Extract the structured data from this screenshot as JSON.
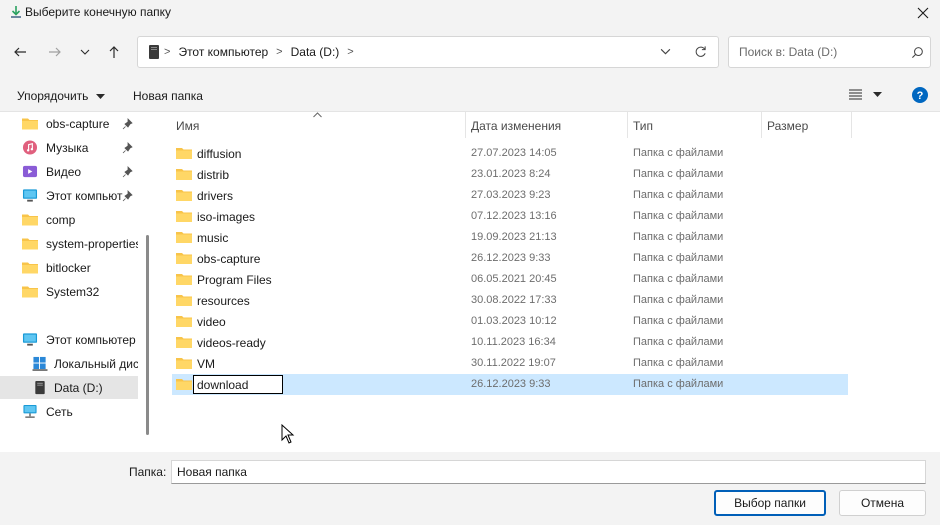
{
  "window": {
    "title": "Выберите конечную папку"
  },
  "nav": {
    "breadcrumbs": [
      "Этот компьютер",
      "Data (D:)"
    ],
    "search_placeholder": "Поиск в: Data (D:)"
  },
  "toolbar": {
    "organize_label": "Упорядочить",
    "new_folder_label": "Новая папка"
  },
  "sidebar": {
    "quick_access": [
      {
        "label": "obs-capture",
        "icon": "folder-icon",
        "pinned": true
      },
      {
        "label": "Музыка",
        "icon": "music-icon",
        "pinned": true
      },
      {
        "label": "Видео",
        "icon": "video-icon",
        "pinned": true
      },
      {
        "label": "Этот компьют",
        "icon": "computer-icon",
        "pinned": true
      },
      {
        "label": "comp",
        "icon": "folder-icon",
        "pinned": false
      },
      {
        "label": "system-properties",
        "icon": "folder-icon",
        "pinned": false
      },
      {
        "label": "bitlocker",
        "icon": "folder-icon",
        "pinned": false
      },
      {
        "label": "System32",
        "icon": "folder-icon",
        "pinned": false
      }
    ],
    "tree": [
      {
        "label": "Этот компьютер",
        "icon": "computer-icon"
      },
      {
        "label": "Локальный дис",
        "icon": "drive-icon"
      },
      {
        "label": "Data (D:)",
        "icon": "drive-icon",
        "selected": true
      },
      {
        "label": "Сеть",
        "icon": "network-icon"
      }
    ]
  },
  "columns": {
    "name": "Имя",
    "date": "Дата изменения",
    "type": "Тип",
    "size": "Размер"
  },
  "files": [
    {
      "name": "diffusion",
      "date": "27.07.2023 14:05",
      "type": "Папка с файлами"
    },
    {
      "name": "distrib",
      "date": "23.01.2023 8:24",
      "type": "Папка с файлами"
    },
    {
      "name": "drivers",
      "date": "27.03.2023 9:23",
      "type": "Папка с файлами"
    },
    {
      "name": "iso-images",
      "date": "07.12.2023 13:16",
      "type": "Папка с файлами"
    },
    {
      "name": "music",
      "date": "19.09.2023 21:13",
      "type": "Папка с файлами"
    },
    {
      "name": "obs-capture",
      "date": "26.12.2023 9:33",
      "type": "Папка с файлами"
    },
    {
      "name": "Program Files",
      "date": "06.05.2021 20:45",
      "type": "Папка с файлами"
    },
    {
      "name": "resources",
      "date": "30.08.2022 17:33",
      "type": "Папка с файлами"
    },
    {
      "name": "video",
      "date": "01.03.2023 10:12",
      "type": "Папка с файлами"
    },
    {
      "name": "videos-ready",
      "date": "10.11.2023 16:34",
      "type": "Папка с файлами"
    },
    {
      "name": "VM",
      "date": "30.11.2022 19:07",
      "type": "Папка с файлами"
    }
  ],
  "renaming": {
    "name": "download",
    "date": "26.12.2023 9:33",
    "type": "Папка с файлами"
  },
  "footer": {
    "folder_label": "Папка:",
    "folder_value": "Новая папка",
    "select_label": "Выбор папки",
    "cancel_label": "Отмена"
  },
  "colors": {
    "accent": "#005fb8",
    "selection": "#cce8ff",
    "folder": "#f8c44a"
  }
}
